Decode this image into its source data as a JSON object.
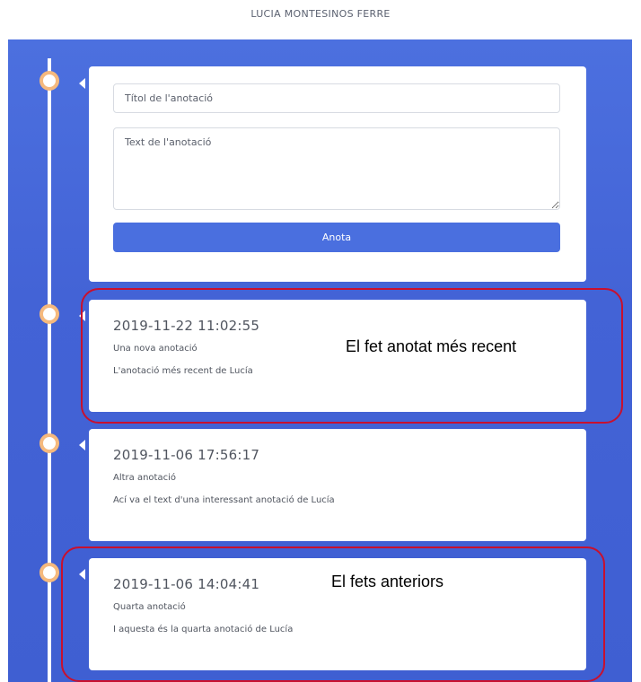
{
  "header": {
    "user_name": "LUCIA MONTESINOS FERRE"
  },
  "form": {
    "title_placeholder": "Títol de l'anotació",
    "text_placeholder": "Text de l'anotació",
    "submit_label": "Anota"
  },
  "entries": [
    {
      "date": "2019-11-22 11:02:55",
      "title": "Una nova anotació",
      "text": "L'anotació més recent de Lucía"
    },
    {
      "date": "2019-11-06 17:56:17",
      "title": "Altra anotació",
      "text": "Ací va el text d'una interessant anotació de Lucía"
    },
    {
      "date": "2019-11-06 14:04:41",
      "title": "Quarta anotació",
      "text": "I aquesta és la quarta anotació de Lucía"
    }
  ],
  "annotations": {
    "recent": "El fet anotat més recent",
    "previous": "El fets anteriors"
  },
  "colors": {
    "board": "#4363d6",
    "button": "#4a6fdf",
    "dot_ring": "#f5b97d",
    "highlight": "#c8102e"
  }
}
